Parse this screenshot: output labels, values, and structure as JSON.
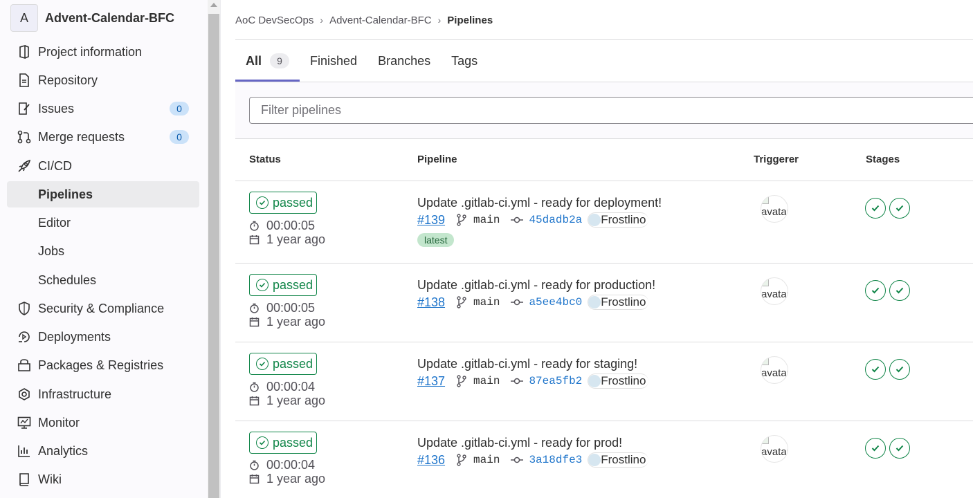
{
  "project": {
    "avatar_letter": "A",
    "name": "Advent-Calendar-BFC"
  },
  "sidebar": {
    "items": [
      {
        "label": "Project information",
        "icon": "project-information-icon"
      },
      {
        "label": "Repository",
        "icon": "document-icon"
      },
      {
        "label": "Issues",
        "icon": "issues-icon",
        "count": "0"
      },
      {
        "label": "Merge requests",
        "icon": "merge-request-icon",
        "count": "0"
      },
      {
        "label": "CI/CD",
        "icon": "rocket-icon"
      },
      {
        "label": "Pipelines"
      },
      {
        "label": "Editor"
      },
      {
        "label": "Jobs"
      },
      {
        "label": "Schedules"
      },
      {
        "label": "Security & Compliance",
        "icon": "shield-icon"
      },
      {
        "label": "Deployments",
        "icon": "deployments-icon"
      },
      {
        "label": "Packages & Registries",
        "icon": "package-icon"
      },
      {
        "label": "Infrastructure",
        "icon": "cloud-gear-icon"
      },
      {
        "label": "Monitor",
        "icon": "monitor-icon"
      },
      {
        "label": "Analytics",
        "icon": "chart-icon"
      },
      {
        "label": "Wiki",
        "icon": "book-icon"
      }
    ]
  },
  "breadcrumb": {
    "items": [
      "AoC DevSecOps",
      "Advent-Calendar-BFC",
      "Pipelines"
    ]
  },
  "tabs": [
    {
      "label": "All",
      "count": "9"
    },
    {
      "label": "Finished"
    },
    {
      "label": "Branches"
    },
    {
      "label": "Tags"
    }
  ],
  "filter": {
    "placeholder": "Filter pipelines"
  },
  "table": {
    "headers": {
      "status": "Status",
      "pipeline": "Pipeline",
      "triggerer": "Triggerer",
      "stages": "Stages"
    },
    "rows": [
      {
        "status": "passed",
        "duration": "00:00:05",
        "finished": "1 year ago",
        "title": "Update .gitlab-ci.yml - ready for deployment!",
        "id": "#139",
        "branch": "main",
        "sha": "45dadb2a",
        "author": "Frostlino",
        "avatar_alt": "avatar",
        "latest": "latest"
      },
      {
        "status": "passed",
        "duration": "00:00:05",
        "finished": "1 year ago",
        "title": "Update .gitlab-ci.yml - ready for production!",
        "id": "#138",
        "branch": "main",
        "sha": "a5ee4bc0",
        "author": "Frostlino",
        "avatar_alt": "avatar"
      },
      {
        "status": "passed",
        "duration": "00:00:04",
        "finished": "1 year ago",
        "title": "Update .gitlab-ci.yml - ready for staging!",
        "id": "#137",
        "branch": "main",
        "sha": "87ea5fb2",
        "author": "Frostlino",
        "avatar_alt": "avatar"
      },
      {
        "status": "passed",
        "duration": "00:00:04",
        "finished": "1 year ago",
        "title": "Update .gitlab-ci.yml - ready for prod!",
        "id": "#136",
        "branch": "main",
        "sha": "3a18dfe3",
        "author": "Frostlino",
        "avatar_alt": "avatar"
      }
    ]
  },
  "colors": {
    "success": "#108548",
    "link": "#1f75cb",
    "active_tab": "#6666c4",
    "badge_bg": "#cbe2f9"
  }
}
